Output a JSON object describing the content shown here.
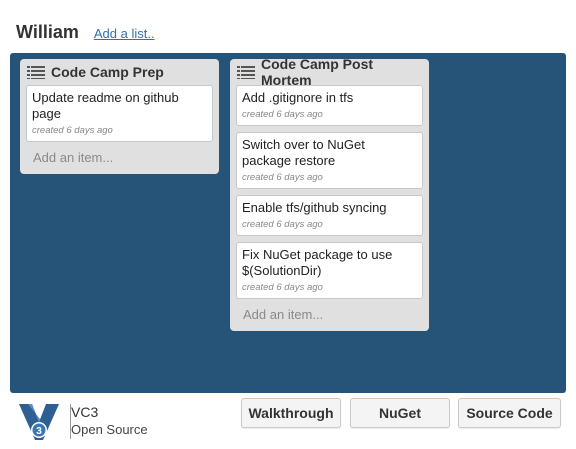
{
  "header": {
    "board_title": "William",
    "add_list_label": "Add a list.."
  },
  "lists": [
    {
      "title": "Code Camp Prep",
      "cards": [
        {
          "title": "Update readme on github page",
          "meta": "created 6 days ago"
        }
      ],
      "add_item_label": "Add an item..."
    },
    {
      "title": "Code Camp Post Mortem",
      "cards": [
        {
          "title": "Add .gitignore in tfs",
          "meta": "created 6 days ago"
        },
        {
          "title": "Switch over to NuGet package restore",
          "meta": "created 6 days ago"
        },
        {
          "title": "Enable tfs/github syncing",
          "meta": "created 6 days ago"
        },
        {
          "title": "Fix NuGet package to use $(SolutionDir)",
          "meta": "created 6 days ago"
        }
      ],
      "add_item_label": "Add an item..."
    }
  ],
  "footer": {
    "logo_letter": "3",
    "brand_name": "VC3",
    "brand_sub": "Open Source",
    "buttons": {
      "walkthrough": "Walkthrough",
      "nuget": "NuGet",
      "source_code": "Source Code"
    }
  },
  "colors": {
    "board": "#255478",
    "list": "#e0e0e0",
    "link": "#3b6ea5",
    "logo": "#2e5f92"
  },
  "icons": {
    "list_icon": "list-lines-icon",
    "logo": "vc3-logo-icon"
  }
}
